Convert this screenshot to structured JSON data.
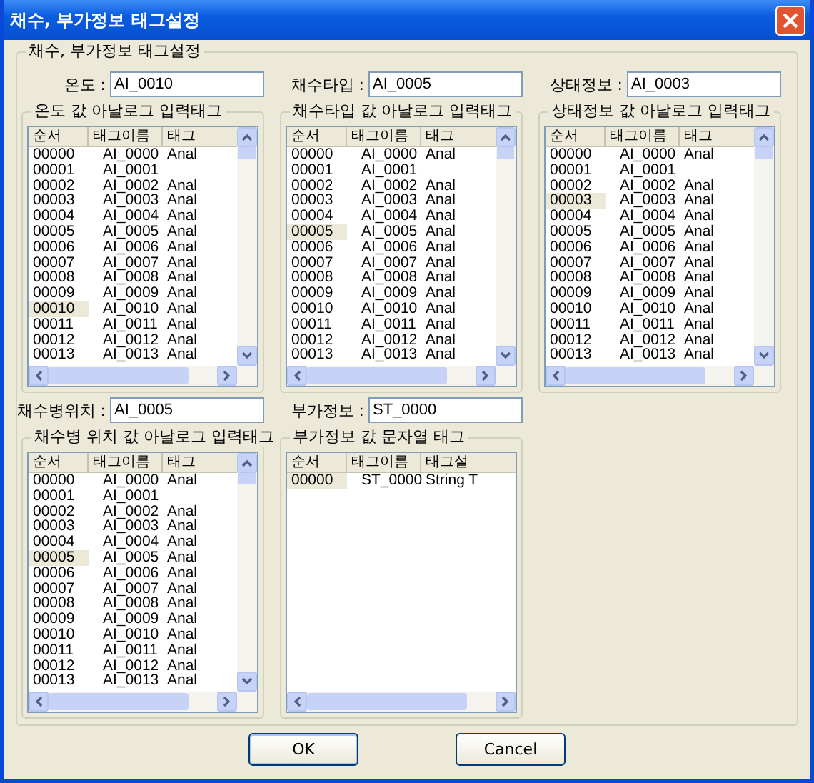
{
  "window": {
    "title": "채수, 부가정보 태그설정"
  },
  "group_title": "채수, 부가정보 태그설정",
  "sections": [
    {
      "field": {
        "label": "온도 :",
        "value": "AI_0010"
      },
      "list": {
        "title": "온도 값 아날로그 입력태그",
        "vscroll": true,
        "columns": [
          "순서",
          "태그이름",
          "태그"
        ],
        "rows": [
          {
            "cells": [
              "00000",
              "AI_0000",
              "Anal"
            ],
            "selected": false
          },
          {
            "cells": [
              "00001",
              "AI_0001",
              ""
            ],
            "selected": false
          },
          {
            "cells": [
              "00002",
              "AI_0002",
              "Anal"
            ],
            "selected": false
          },
          {
            "cells": [
              "00003",
              "AI_0003",
              "Anal"
            ],
            "selected": false
          },
          {
            "cells": [
              "00004",
              "AI_0004",
              "Anal"
            ],
            "selected": false
          },
          {
            "cells": [
              "00005",
              "AI_0005",
              "Anal"
            ],
            "selected": false
          },
          {
            "cells": [
              "00006",
              "AI_0006",
              "Anal"
            ],
            "selected": false
          },
          {
            "cells": [
              "00007",
              "AI_0007",
              "Anal"
            ],
            "selected": false
          },
          {
            "cells": [
              "00008",
              "AI_0008",
              "Anal"
            ],
            "selected": false
          },
          {
            "cells": [
              "00009",
              "AI_0009",
              "Anal"
            ],
            "selected": false
          },
          {
            "cells": [
              "00010",
              "AI_0010",
              "Anal"
            ],
            "selected": true
          },
          {
            "cells": [
              "00011",
              "AI_0011",
              "Anal"
            ],
            "selected": false
          },
          {
            "cells": [
              "00012",
              "AI_0012",
              "Anal"
            ],
            "selected": false
          },
          {
            "cells": [
              "00013",
              "AI_0013",
              "Anal"
            ],
            "selected": false
          }
        ]
      }
    },
    {
      "field": {
        "label": "채수타입 :",
        "value": "AI_0005"
      },
      "list": {
        "title": "채수타입 값 아날로그 입력태그",
        "vscroll": true,
        "columns": [
          "순서",
          "태그이름",
          "태그"
        ],
        "rows": [
          {
            "cells": [
              "00000",
              "AI_0000",
              "Anal"
            ],
            "selected": false
          },
          {
            "cells": [
              "00001",
              "AI_0001",
              ""
            ],
            "selected": false
          },
          {
            "cells": [
              "00002",
              "AI_0002",
              "Anal"
            ],
            "selected": false
          },
          {
            "cells": [
              "00003",
              "AI_0003",
              "Anal"
            ],
            "selected": false
          },
          {
            "cells": [
              "00004",
              "AI_0004",
              "Anal"
            ],
            "selected": false
          },
          {
            "cells": [
              "00005",
              "AI_0005",
              "Anal"
            ],
            "selected": true
          },
          {
            "cells": [
              "00006",
              "AI_0006",
              "Anal"
            ],
            "selected": false
          },
          {
            "cells": [
              "00007",
              "AI_0007",
              "Anal"
            ],
            "selected": false
          },
          {
            "cells": [
              "00008",
              "AI_0008",
              "Anal"
            ],
            "selected": false
          },
          {
            "cells": [
              "00009",
              "AI_0009",
              "Anal"
            ],
            "selected": false
          },
          {
            "cells": [
              "00010",
              "AI_0010",
              "Anal"
            ],
            "selected": false
          },
          {
            "cells": [
              "00011",
              "AI_0011",
              "Anal"
            ],
            "selected": false
          },
          {
            "cells": [
              "00012",
              "AI_0012",
              "Anal"
            ],
            "selected": false
          },
          {
            "cells": [
              "00013",
              "AI_0013",
              "Anal"
            ],
            "selected": false
          }
        ]
      }
    },
    {
      "field": {
        "label": "상태정보 :",
        "value": "AI_0003"
      },
      "list": {
        "title": "상태정보 값 아날로그 입력태그",
        "vscroll": true,
        "columns": [
          "순서",
          "태그이름",
          "태그"
        ],
        "rows": [
          {
            "cells": [
              "00000",
              "AI_0000",
              "Anal"
            ],
            "selected": false
          },
          {
            "cells": [
              "00001",
              "AI_0001",
              ""
            ],
            "selected": false
          },
          {
            "cells": [
              "00002",
              "AI_0002",
              "Anal"
            ],
            "selected": false
          },
          {
            "cells": [
              "00003",
              "AI_0003",
              "Anal"
            ],
            "selected": true
          },
          {
            "cells": [
              "00004",
              "AI_0004",
              "Anal"
            ],
            "selected": false
          },
          {
            "cells": [
              "00005",
              "AI_0005",
              "Anal"
            ],
            "selected": false
          },
          {
            "cells": [
              "00006",
              "AI_0006",
              "Anal"
            ],
            "selected": false
          },
          {
            "cells": [
              "00007",
              "AI_0007",
              "Anal"
            ],
            "selected": false
          },
          {
            "cells": [
              "00008",
              "AI_0008",
              "Anal"
            ],
            "selected": false
          },
          {
            "cells": [
              "00009",
              "AI_0009",
              "Anal"
            ],
            "selected": false
          },
          {
            "cells": [
              "00010",
              "AI_0010",
              "Anal"
            ],
            "selected": false
          },
          {
            "cells": [
              "00011",
              "AI_0011",
              "Anal"
            ],
            "selected": false
          },
          {
            "cells": [
              "00012",
              "AI_0012",
              "Anal"
            ],
            "selected": false
          },
          {
            "cells": [
              "00013",
              "AI_0013",
              "Anal"
            ],
            "selected": false
          }
        ]
      }
    },
    {
      "field": {
        "label": "채수병위치 :",
        "value": "AI_0005"
      },
      "list": {
        "title": "채수병 위치 값 아날로그 입력태그",
        "vscroll": true,
        "columns": [
          "순서",
          "태그이름",
          "태그"
        ],
        "rows": [
          {
            "cells": [
              "00000",
              "AI_0000",
              "Anal"
            ],
            "selected": false
          },
          {
            "cells": [
              "00001",
              "AI_0001",
              ""
            ],
            "selected": false
          },
          {
            "cells": [
              "00002",
              "AI_0002",
              "Anal"
            ],
            "selected": false
          },
          {
            "cells": [
              "00003",
              "AI_0003",
              "Anal"
            ],
            "selected": false
          },
          {
            "cells": [
              "00004",
              "AI_0004",
              "Anal"
            ],
            "selected": false
          },
          {
            "cells": [
              "00005",
              "AI_0005",
              "Anal"
            ],
            "selected": true
          },
          {
            "cells": [
              "00006",
              "AI_0006",
              "Anal"
            ],
            "selected": false
          },
          {
            "cells": [
              "00007",
              "AI_0007",
              "Anal"
            ],
            "selected": false
          },
          {
            "cells": [
              "00008",
              "AI_0008",
              "Anal"
            ],
            "selected": false
          },
          {
            "cells": [
              "00009",
              "AI_0009",
              "Anal"
            ],
            "selected": false
          },
          {
            "cells": [
              "00010",
              "AI_0010",
              "Anal"
            ],
            "selected": false
          },
          {
            "cells": [
              "00011",
              "AI_0011",
              "Anal"
            ],
            "selected": false
          },
          {
            "cells": [
              "00012",
              "AI_0012",
              "Anal"
            ],
            "selected": false
          },
          {
            "cells": [
              "00013",
              "AI_0013",
              "Anal"
            ],
            "selected": false
          }
        ]
      }
    },
    {
      "field": {
        "label": "부가정보 :",
        "value": "ST_0000"
      },
      "list": {
        "title": "부가정보 값 문자열 태그",
        "vscroll": false,
        "columns": [
          "순서",
          "태그이름",
          "태그설"
        ],
        "rows": [
          {
            "cells": [
              "00000",
              "ST_0000",
              "String T"
            ],
            "selected": true
          }
        ]
      }
    }
  ],
  "buttons": [
    "OK",
    "Cancel"
  ]
}
